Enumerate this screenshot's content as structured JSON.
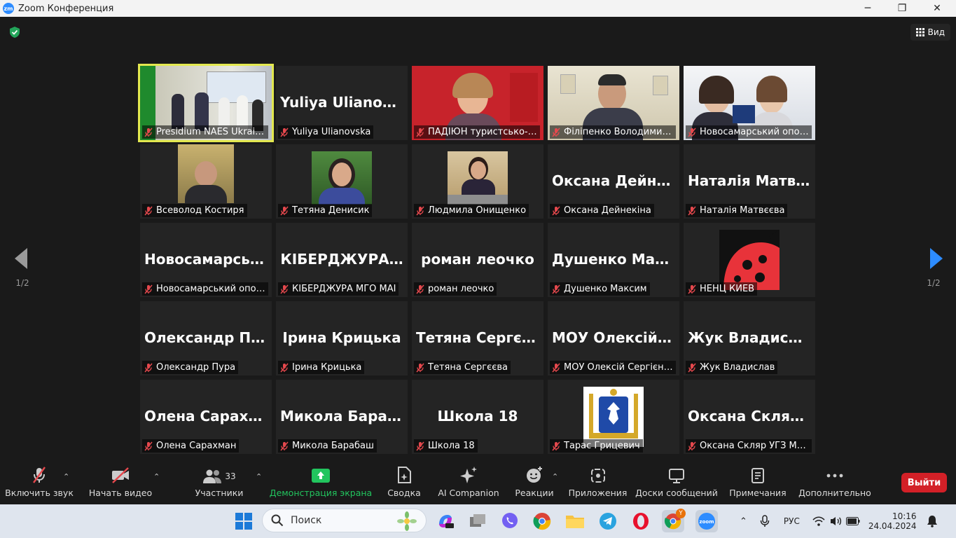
{
  "window": {
    "title": "Zoom Конференция",
    "logo_text": "zm",
    "minimize": "─",
    "restore": "❐",
    "close": "✕"
  },
  "stage": {
    "view_label": "Вид",
    "page_left": "1/2",
    "page_right": "1/2"
  },
  "tiles": [
    {
      "big": "",
      "label": "Presidium NAES Ukraine"
    },
    {
      "big": "Yuliya Ulianovska",
      "label": "Yuliya Ulianovska"
    },
    {
      "big": "",
      "label": "ПАДІЮН туристсько-кра…"
    },
    {
      "big": "",
      "label": "Філіпенко Володимир М…"
    },
    {
      "big": "",
      "label": "Новосамарський опорн…"
    },
    {
      "big": "",
      "label": "Всеволод Костиря"
    },
    {
      "big": "",
      "label": "Тетяна Денисик"
    },
    {
      "big": "",
      "label": "Людмила Онищенко"
    },
    {
      "big": "Оксана Дейнек…",
      "label": "Оксана Дейнекіна"
    },
    {
      "big": "Наталія Матвєє…",
      "label": "Наталія Матвєєва"
    },
    {
      "big": "Новосамарськ…",
      "label": "Новосамарський опорн…"
    },
    {
      "big": "КІБЕРДЖУРА…",
      "label": "КІБЕРДЖУРА МГО МАІ"
    },
    {
      "big": "роман леочко",
      "label": "роман леочко"
    },
    {
      "big": "Душенко Макс…",
      "label": "Душенко Максим"
    },
    {
      "big": "",
      "label": "НЕНЦ КИЕВ"
    },
    {
      "big": "Олександр Пура",
      "label": "Олександр Пура"
    },
    {
      "big": "Ірина Крицька",
      "label": "Ірина Крицька"
    },
    {
      "big": "Тетяна Сергєєва",
      "label": "Тетяна Сергєєва"
    },
    {
      "big": "МОУ Олексій С…",
      "label": "МОУ Олексій Сергієнко"
    },
    {
      "big": "Жук Владислав",
      "label": "Жук Владислав"
    },
    {
      "big": "Олена Сарахман",
      "label": "Олена Сарахман"
    },
    {
      "big": "Микола Бараб…",
      "label": "Микола Барабаш"
    },
    {
      "big": "Школа 18",
      "label": "Школа 18"
    },
    {
      "big": "",
      "label": "Тарас Грицевич"
    },
    {
      "big": "Оксана Скляр…",
      "label": "Оксана Скляр УГЗ МОУ"
    }
  ],
  "toolbar": {
    "unmute": "Включить звук",
    "start_video": "Начать видео",
    "participants": "Участники",
    "participants_count": "33",
    "share": "Демонстрация экрана",
    "summary": "Сводка",
    "ai": "AI Companion",
    "reactions": "Реакции",
    "apps": "Приложения",
    "boards": "Доски сообщений",
    "notes": "Примечания",
    "more": "Дополнительно",
    "exit": "Выйти"
  },
  "taskbar": {
    "search_placeholder": "Поиск",
    "lang": "РУС",
    "time": "10:16",
    "date": "24.04.2024",
    "badge": "Y"
  }
}
